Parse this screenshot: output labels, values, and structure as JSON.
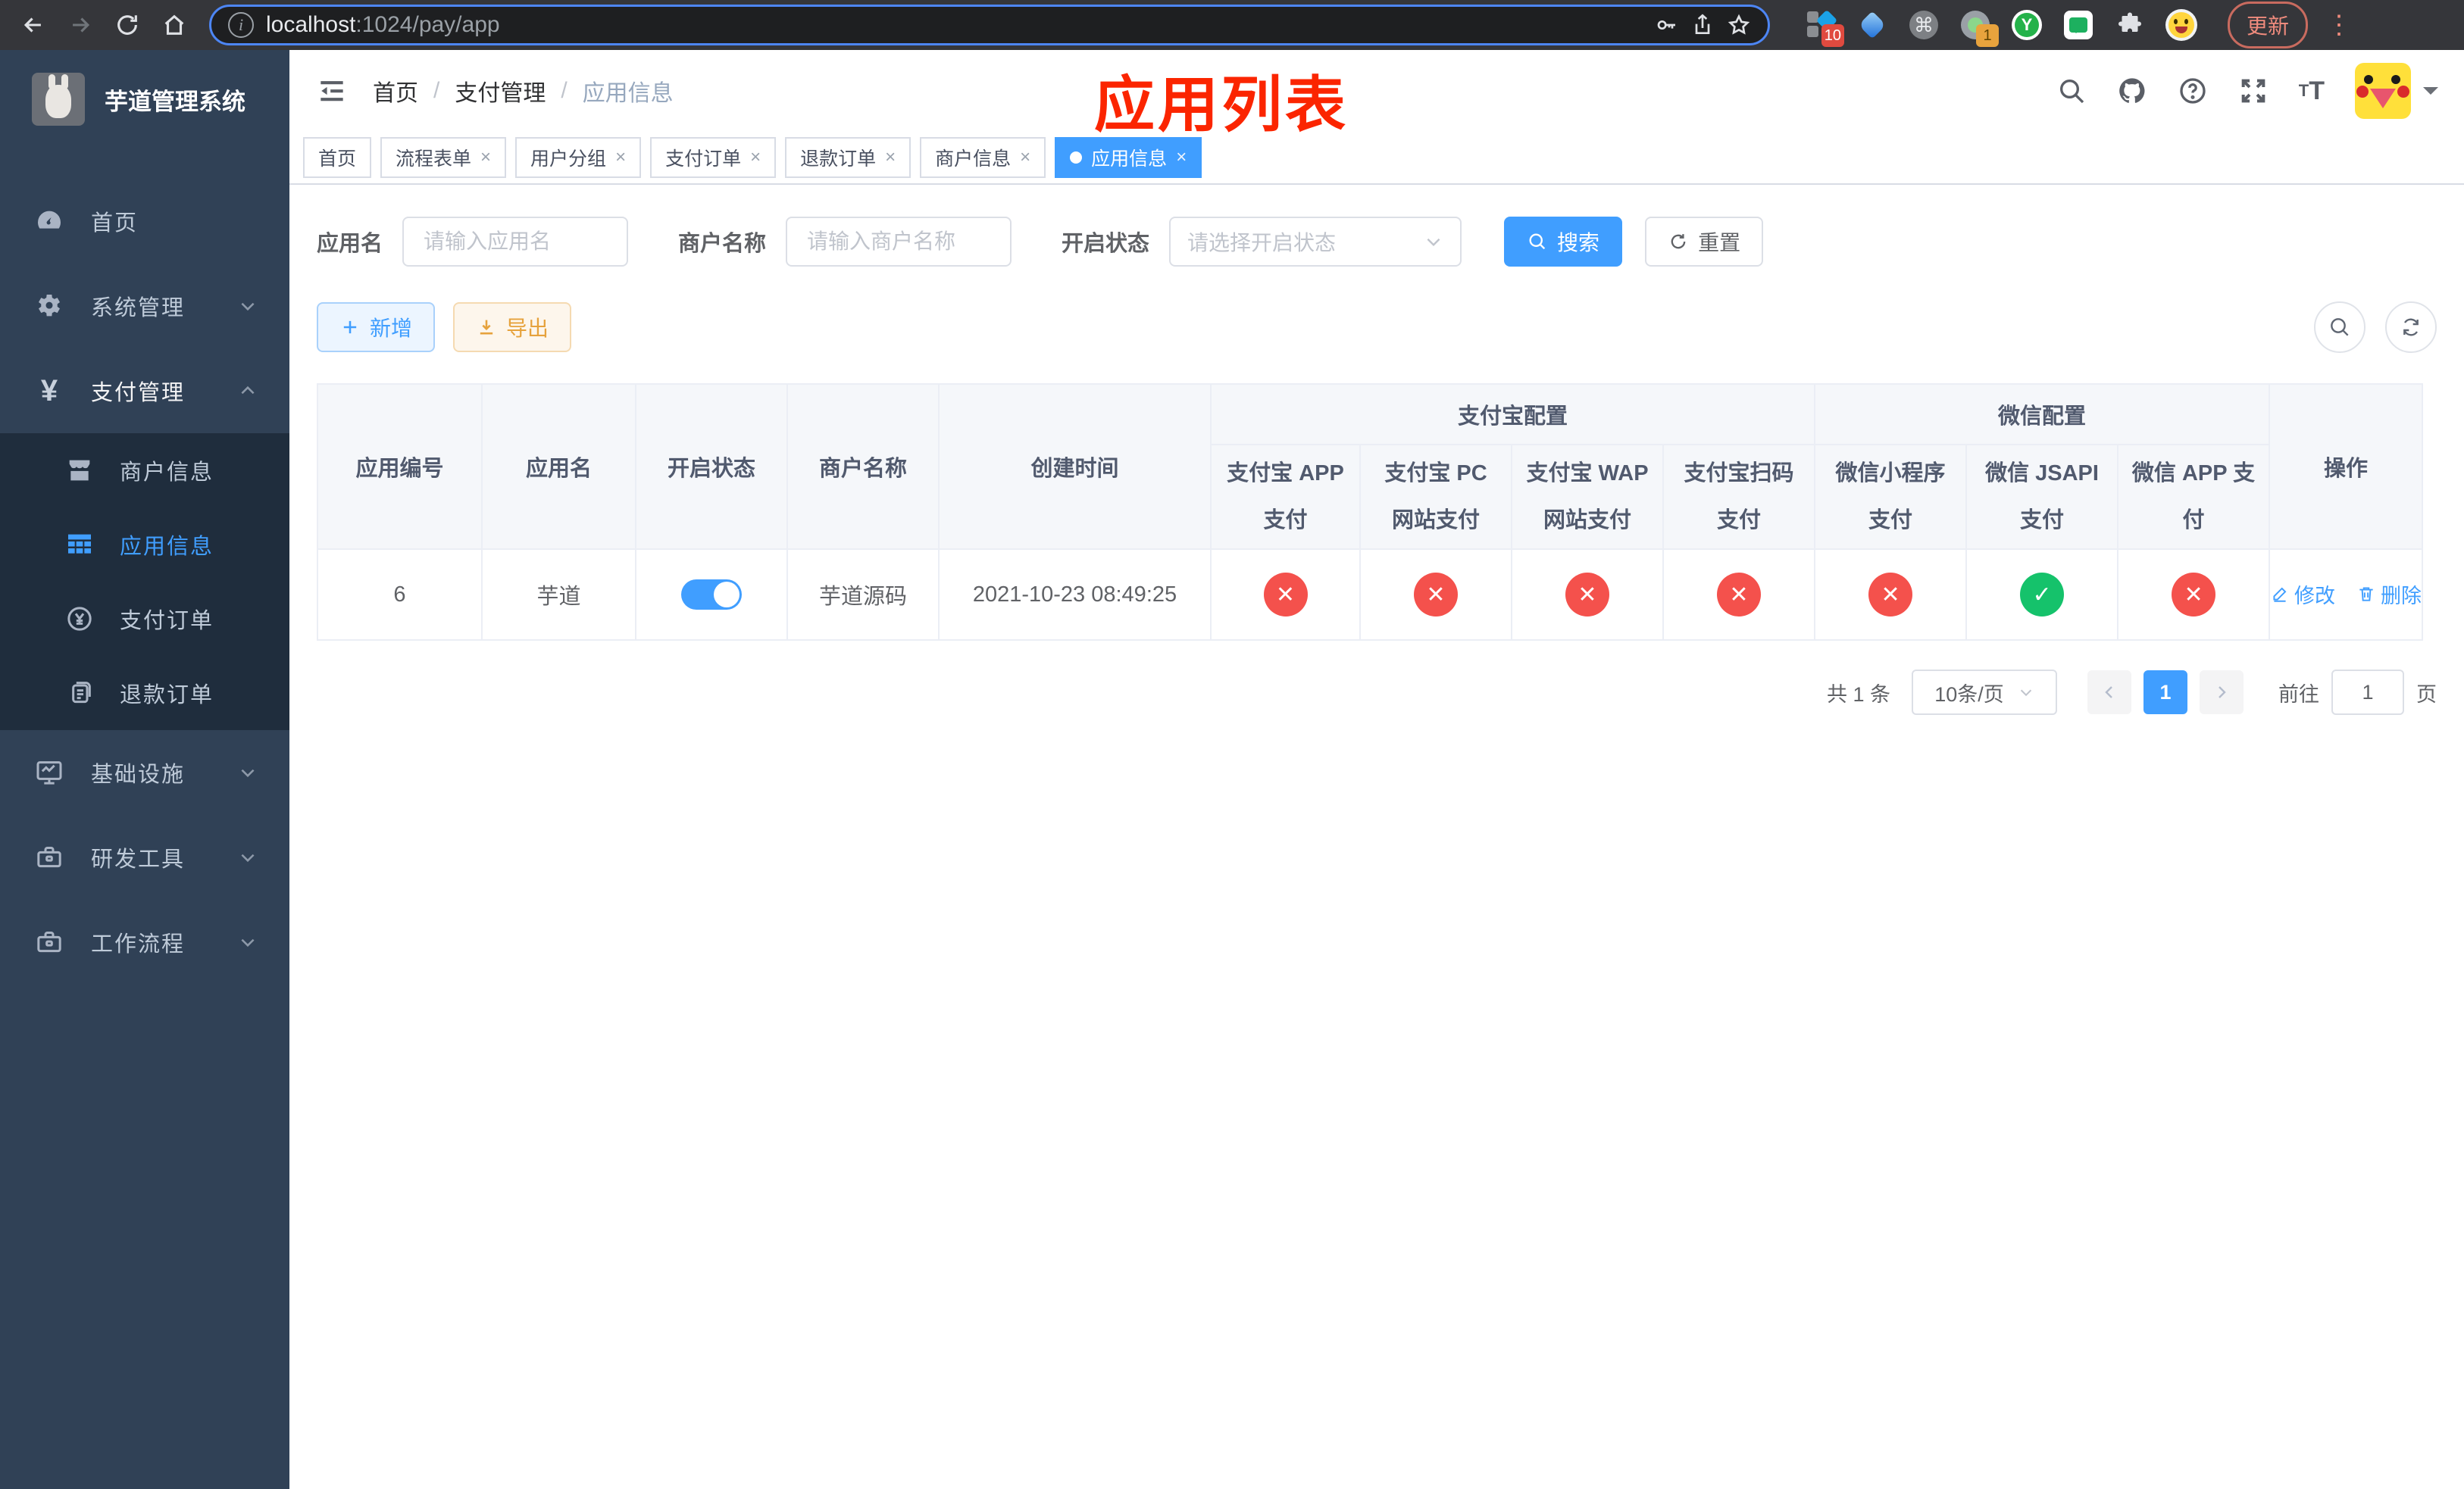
{
  "browser": {
    "url": {
      "host": "localhost",
      "path": ":1024/pay/app"
    },
    "update_button": "更新",
    "extension_badges": {
      "first": "10",
      "second": "1"
    },
    "y_extension_letter": "Y",
    "command_glyph": "⌘"
  },
  "sidebar": {
    "title": "芋道管理系统",
    "items": {
      "home": "首页",
      "system": "系统管理",
      "pay": "支付管理",
      "merchant": "商户信息",
      "app": "应用信息",
      "pay_order": "支付订单",
      "refund_order": "退款订单",
      "infra": "基础设施",
      "dev_tools": "研发工具",
      "workflow": "工作流程"
    }
  },
  "navbar": {
    "breadcrumb": [
      "首页",
      "支付管理",
      "应用信息"
    ]
  },
  "annotation": "应用列表",
  "tabs": [
    {
      "label": "首页",
      "closable": false,
      "active": false
    },
    {
      "label": "流程表单",
      "closable": true,
      "active": false
    },
    {
      "label": "用户分组",
      "closable": true,
      "active": false
    },
    {
      "label": "支付订单",
      "closable": true,
      "active": false
    },
    {
      "label": "退款订单",
      "closable": true,
      "active": false
    },
    {
      "label": "商户信息",
      "closable": true,
      "active": false
    },
    {
      "label": "应用信息",
      "closable": true,
      "active": true
    }
  ],
  "filters": {
    "app_name": {
      "label": "应用名",
      "placeholder": "请输入应用名",
      "value": ""
    },
    "merchant_name": {
      "label": "商户名称",
      "placeholder": "请输入商户名称",
      "value": ""
    },
    "status": {
      "label": "开启状态",
      "placeholder": "请选择开启状态",
      "value": ""
    },
    "search_button": "搜索",
    "reset_button": "重置"
  },
  "toolbar": {
    "add_button": "新增",
    "export_button": "导出"
  },
  "table": {
    "columns": [
      "应用编号",
      "应用名",
      "开启状态",
      "商户名称",
      "创建时间"
    ],
    "groups": {
      "alipay": "支付宝配置",
      "wechat": "微信配置",
      "actions": "操作"
    },
    "subcolumns": [
      "支付宝 APP 支付",
      "支付宝 PC 网站支付",
      "支付宝 WAP 网站支付",
      "支付宝扫码支付",
      "微信小程序支付",
      "微信 JSAPI 支付",
      "微信 APP 支付"
    ],
    "row": {
      "app_id": "6",
      "app_name": "芋道",
      "status_on": true,
      "merchant": "芋道源码",
      "created_at": "2021-10-23 08:49:25",
      "channels": [
        {
          "name": "alipay-app-pay",
          "enabled": false
        },
        {
          "name": "alipay-pc-pay",
          "enabled": false
        },
        {
          "name": "alipay-wap-pay",
          "enabled": false
        },
        {
          "name": "alipay-qr-pay",
          "enabled": false
        },
        {
          "name": "wechat-miniapp-pay",
          "enabled": false
        },
        {
          "name": "wechat-jsapi-pay",
          "enabled": true
        },
        {
          "name": "wechat-app-pay",
          "enabled": false
        }
      ],
      "edit_label": "修改",
      "delete_label": "删除"
    }
  },
  "pagination": {
    "total": "共 1 条",
    "page_size": "10条/页",
    "current_page": "1",
    "goto_label": "前往",
    "goto_value": "1",
    "goto_unit": "页"
  },
  "colors": {
    "primary": "#409eff",
    "success": "#15c26b",
    "danger": "#f4514c",
    "warning": "#e6a23c",
    "sidebar_bg": "#304156",
    "submenu_bg": "#1f2d3d",
    "annotation": "#fb2500"
  }
}
